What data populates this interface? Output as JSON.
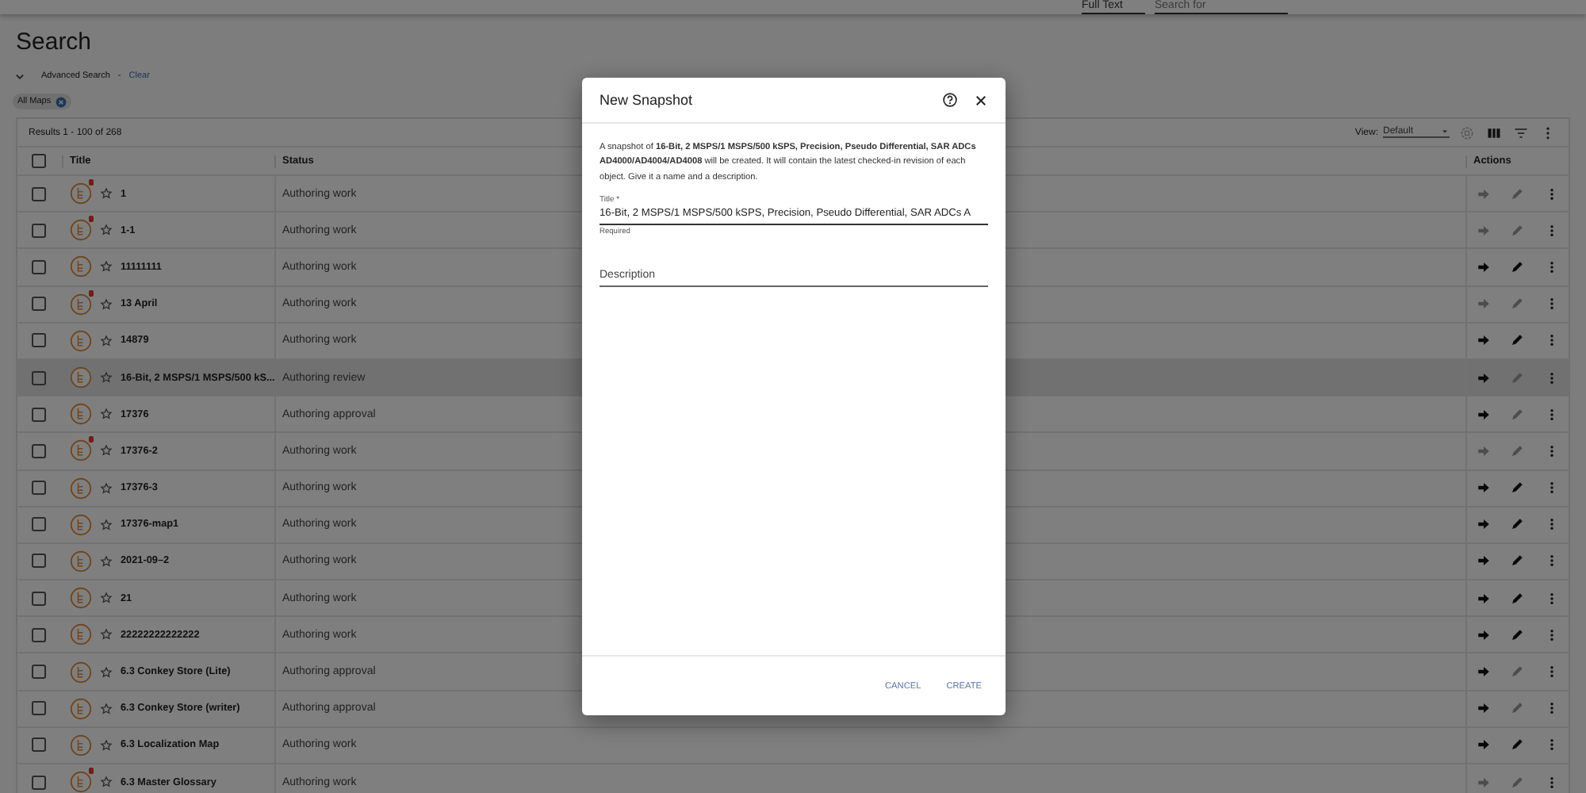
{
  "header": {
    "search_type": "Full Text",
    "search_placeholder": "Search for"
  },
  "page_title": "Search",
  "advanced_search": {
    "label": "Advanced Search",
    "separator": "-",
    "clear": "Clear",
    "expanded": true
  },
  "filter_chips": [
    {
      "label": "All Maps"
    }
  ],
  "results": {
    "summary": "Results 1 - 100 of 268",
    "view_label": "View:",
    "view_value": "Default"
  },
  "table": {
    "columns": [
      "Title",
      "Status",
      "Actions"
    ],
    "select_all_checked": false,
    "rows": [
      {
        "title": "1",
        "status": "Authoring work",
        "locked": true,
        "open_enabled": false,
        "edit_enabled": false,
        "checked": false,
        "selected": false
      },
      {
        "title": "1-1",
        "status": "Authoring work",
        "locked": true,
        "open_enabled": false,
        "edit_enabled": false,
        "checked": false,
        "selected": false
      },
      {
        "title": "11111111",
        "status": "Authoring work",
        "locked": false,
        "open_enabled": true,
        "edit_enabled": true,
        "checked": false,
        "selected": false
      },
      {
        "title": "13 April",
        "status": "Authoring work",
        "locked": true,
        "open_enabled": false,
        "edit_enabled": false,
        "checked": false,
        "selected": false
      },
      {
        "title": "14879",
        "status": "Authoring work",
        "locked": false,
        "open_enabled": true,
        "edit_enabled": true,
        "checked": false,
        "selected": false
      },
      {
        "title": "16-Bit, 2 MSPS/1 MSPS/500 kS...",
        "status": "Authoring review",
        "locked": false,
        "open_enabled": true,
        "edit_enabled": false,
        "checked": false,
        "selected": true
      },
      {
        "title": "17376",
        "status": "Authoring approval",
        "locked": false,
        "open_enabled": true,
        "edit_enabled": false,
        "checked": false,
        "selected": false
      },
      {
        "title": "17376-2",
        "status": "Authoring work",
        "locked": true,
        "open_enabled": false,
        "edit_enabled": false,
        "checked": false,
        "selected": false
      },
      {
        "title": "17376-3",
        "status": "Authoring work",
        "locked": false,
        "open_enabled": true,
        "edit_enabled": true,
        "checked": false,
        "selected": false
      },
      {
        "title": "17376-map1",
        "status": "Authoring work",
        "locked": false,
        "open_enabled": true,
        "edit_enabled": true,
        "checked": false,
        "selected": false
      },
      {
        "title": "2021-09–2",
        "status": "Authoring work",
        "locked": false,
        "open_enabled": true,
        "edit_enabled": true,
        "checked": false,
        "selected": false
      },
      {
        "title": "21",
        "status": "Authoring work",
        "locked": false,
        "open_enabled": true,
        "edit_enabled": true,
        "checked": false,
        "selected": false
      },
      {
        "title": "22222222222222",
        "status": "Authoring work",
        "locked": false,
        "open_enabled": true,
        "edit_enabled": true,
        "checked": false,
        "selected": false
      },
      {
        "title": "6.3 Conkey Store (Lite)",
        "status": "Authoring approval",
        "locked": false,
        "open_enabled": true,
        "edit_enabled": false,
        "checked": false,
        "selected": false
      },
      {
        "title": "6.3 Conkey Store (writer)",
        "status": "Authoring approval",
        "locked": false,
        "open_enabled": true,
        "edit_enabled": false,
        "checked": false,
        "selected": false
      },
      {
        "title": "6.3 Localization Map",
        "status": "Authoring work",
        "locked": false,
        "open_enabled": true,
        "edit_enabled": true,
        "checked": false,
        "selected": false
      },
      {
        "title": "6.3 Master Glossary",
        "status": "Authoring work",
        "locked": true,
        "open_enabled": false,
        "edit_enabled": false,
        "checked": false,
        "selected": false
      }
    ]
  },
  "dialog": {
    "title": "New Snapshot",
    "message": "A snapshot of **16-Bit, 2 MSPS/1 MSPS/500 kSPS, Precision, Pseudo Differential, SAR ADCs AD4000/AD4004/AD4008** will be created. It will contain the latest checked-in revision of each object. Give it a name and a description.",
    "title_field": {
      "label": "Title *",
      "value": "16-Bit, 2 MSPS/1 MSPS/500 kSPS, Precision, Pseudo Differential, SAR ADCs A",
      "helper": "Required"
    },
    "description_field": {
      "placeholder": "Description"
    },
    "buttons": [
      "CANCEL",
      "CREATE"
    ]
  }
}
